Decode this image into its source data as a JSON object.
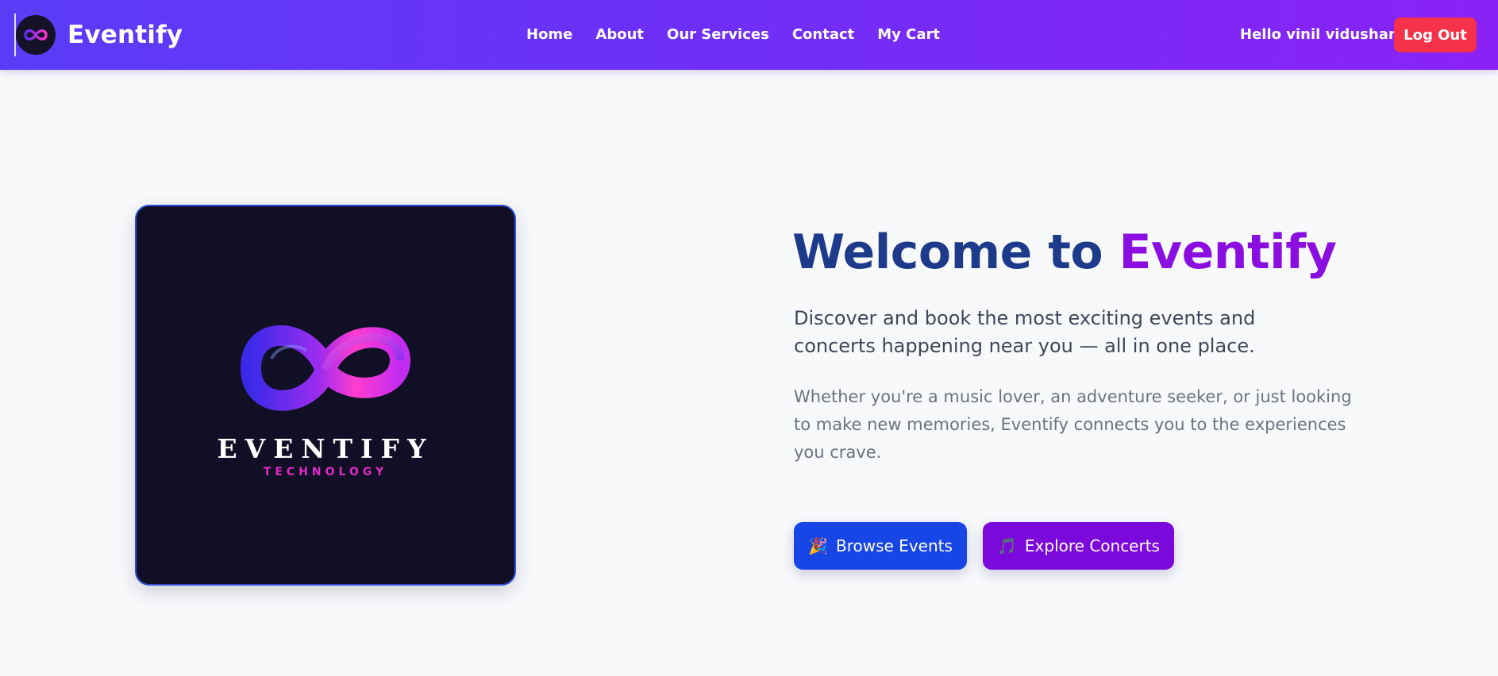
{
  "brand": {
    "name": "Eventify"
  },
  "nav": {
    "links": [
      "Home",
      "About",
      "Our Services",
      "Contact",
      "My Cart"
    ],
    "greeting": "Hello vinil vidushanka",
    "logout_label": "Log Out"
  },
  "hero": {
    "logo_wordmark": "EVENTIFY",
    "logo_subtitle": "TECHNOLOGY",
    "headline_part1": "Welcome to ",
    "headline_part2": "Eventify",
    "lead": "Discover and book the most exciting events and concerts happening near you — all in one place.",
    "body": "Whether you're a music lover, an adventure seeker, or just looking to make new memories, Eventify connects you to the experiences you crave.",
    "browse_emoji": "🎉",
    "browse_label": "Browse Events",
    "concerts_emoji": "🎵",
    "concerts_label": "Explore Concerts"
  },
  "colors": {
    "nav_gradient_start": "#5a3cf7",
    "nav_gradient_end": "#8a22f6",
    "logout": "#f5324a",
    "headline_dark": "#1e3a8a",
    "headline_accent": "#8a0ee0",
    "browse_button": "#1846e6",
    "concerts_button": "#7c09db"
  }
}
